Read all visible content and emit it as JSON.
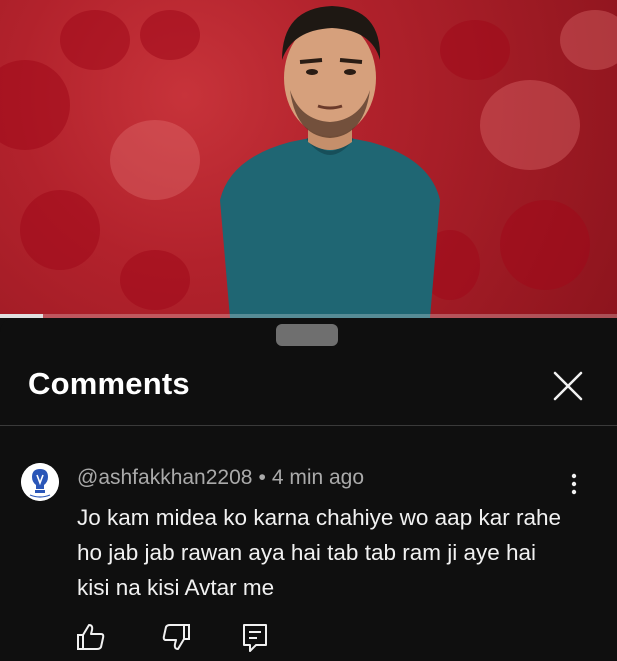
{
  "video": {
    "progress_fraction": 0.07
  },
  "comments_panel": {
    "title": "Comments",
    "comment": {
      "author": "@ashfakkhan2208",
      "separator": "•",
      "time": "4 min ago",
      "text": "Jo kam midea ko karna chahiye wo aap kar rahe ho jab jab rawan aya hai tab tab ram ji aye hai kisi na kisi Avtar me"
    }
  },
  "icons": {
    "close": "close-icon",
    "more": "more-vertical-icon",
    "like": "thumbs-up-icon",
    "dislike": "thumbs-down-icon",
    "reply": "reply-icon"
  },
  "colors": {
    "background": "#0f0f0f",
    "meta_text": "#aaaaaa",
    "primary_text": "#f1f1f1"
  }
}
